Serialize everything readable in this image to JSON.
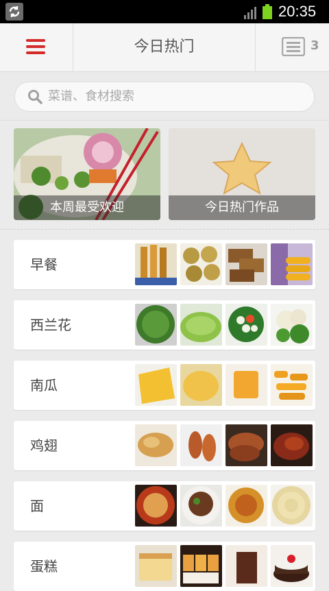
{
  "status_bar": {
    "time": "20:35"
  },
  "header": {
    "title": "今日热门",
    "notes_count": "3"
  },
  "search": {
    "placeholder": "菜谱、食材搜索"
  },
  "features": [
    {
      "label": "本周最受欢迎"
    },
    {
      "label": "今日热门作品"
    }
  ],
  "categories": [
    {
      "name": "早餐"
    },
    {
      "name": "西兰花"
    },
    {
      "name": "南瓜"
    },
    {
      "name": "鸡翅"
    },
    {
      "name": "面"
    },
    {
      "name": "蛋糕"
    }
  ],
  "colors": {
    "accent": "#d42a2a",
    "background": "#ebebeb"
  }
}
